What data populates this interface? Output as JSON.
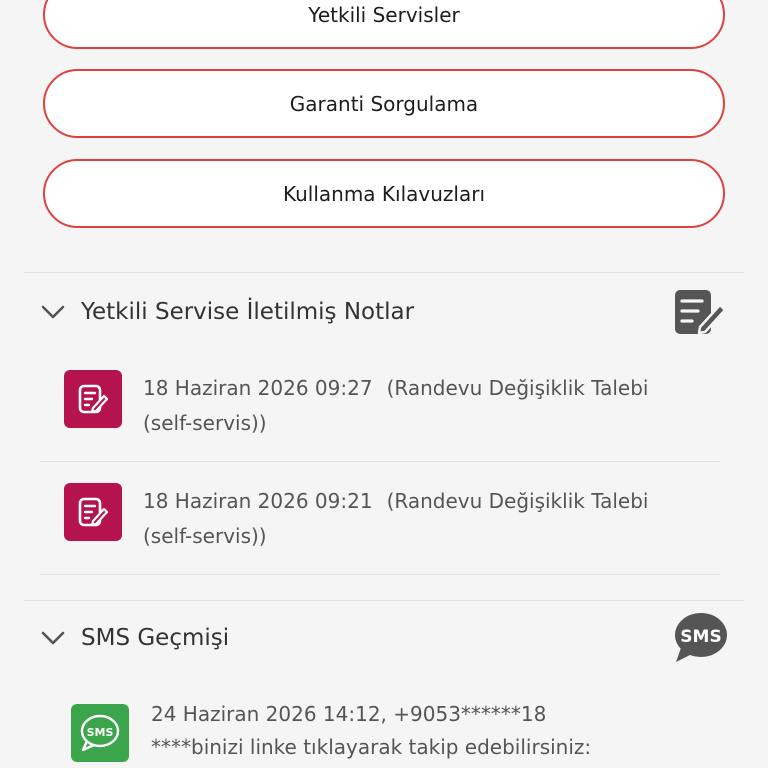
{
  "buttons": {
    "authorized_services": "Yetkili Servisler",
    "warranty_query": "Garanti Sorgulama",
    "user_manuals": "Kullanma Kılavuzları"
  },
  "notes_section": {
    "title": "Yetkili Servise İletilmiş Notlar",
    "items": [
      {
        "date": "18 Haziran 2026 09:27",
        "description": "(Randevu Değişiklik Talebi (self-servis))"
      },
      {
        "date": "18 Haziran 2026 09:21",
        "description": "(Randevu Değişiklik Talebi (self-servis))"
      }
    ]
  },
  "sms_section": {
    "title": "SMS Geçmişi",
    "icon_label": "SMS",
    "items": [
      {
        "header": "24 Haziran 2026 14:12, +9053******18",
        "message": "****binizi linke tıklayarak takip edebilirsiniz:"
      }
    ]
  },
  "colors": {
    "accent_border": "#e0413f",
    "note_icon_bg": "#b5134d",
    "sms_icon_bg": "#3aa54a",
    "header_icon": "#555555"
  },
  "icons": {
    "chevron": "chevron-down-icon",
    "notes_header": "note-edit-icon",
    "sms_header": "sms-bubble-icon",
    "note_item": "note-edit-icon",
    "sms_item": "sms-icon"
  }
}
